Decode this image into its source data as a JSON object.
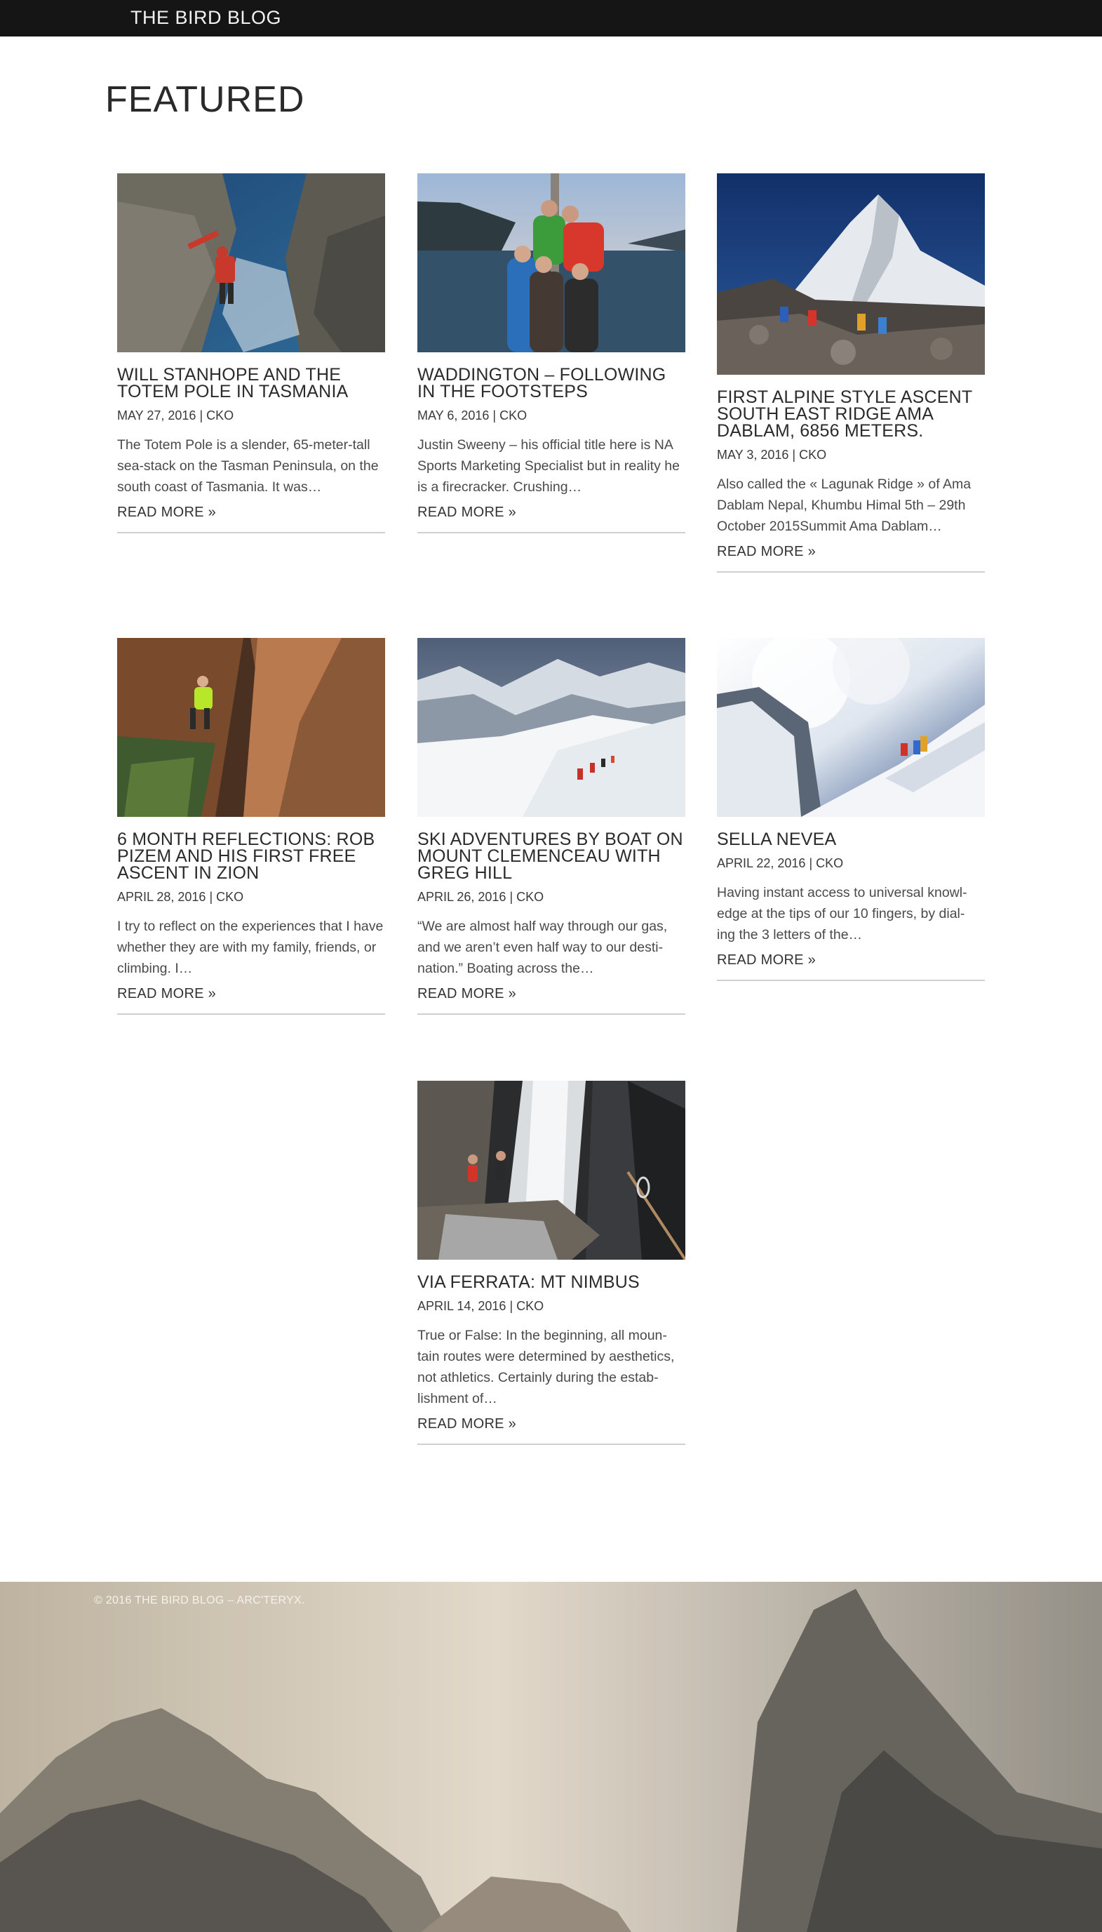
{
  "header": {
    "brand": "THE BIRD BLOG"
  },
  "section": {
    "title": "FEATURED"
  },
  "posts": [
    {
      "title": "WILL STANHOPE AND THE TOTEM POLE IN TASMANIA",
      "date": "MAY 27, 2016",
      "separator": "|",
      "author": "CKO",
      "excerpt": "The Totem Pole is a slender, 65-meter-tall sea-stack on the Tasman Peninsula, on the south coast of Tasmania. It was…",
      "read_more": "READ MORE »"
    },
    {
      "title": "WADDINGTON – FOLLOWING IN THE FOOTSTEPS",
      "date": "MAY 6, 2016",
      "separator": "|",
      "author": "CKO",
      "excerpt": "Justin Sweeny – his official title here is NA Sports Marketing Specialist but in reality he is a firecracker. Crushing…",
      "read_more": "READ MORE »"
    },
    {
      "title": "FIRST ALPINE STYLE ASCENT SOUTH EAST RIDGE AMA DABLAM, 6856 METERS.",
      "date": "MAY 3, 2016",
      "separator": "|",
      "author": "CKO",
      "excerpt": "Also called the « Lagunak Ridge » of Ama Dablam Nepal, Khumbu Himal 5th – 29th October 2015Summit Ama Dablam…",
      "read_more": "READ MORE »"
    },
    {
      "title": "6 MONTH REFLECTIONS: ROB PIZEM AND HIS FIRST FREE ASCENT IN ZION",
      "date": "APRIL 28, 2016",
      "separator": "|",
      "author": "CKO",
      "excerpt": "I try to reflect on the experiences that I have whether they are with my family, friends, or climbing. I…",
      "read_more": "READ MORE »"
    },
    {
      "title": "SKI ADVENTURES BY BOAT ON MOUNT CLEMENCEAU WITH GREG HILL",
      "date": "APRIL 26, 2016",
      "separator": "|",
      "author": "CKO",
      "excerpt": "“We are almost half way through our gas, and we aren’t even half way to our desti- nation.” Boating across the…",
      "read_more": "READ MORE »"
    },
    {
      "title": "SELLA NEVEA",
      "date": "APRIL 22, 2016",
      "separator": "|",
      "author": "CKO",
      "excerpt": "Having instant access to universal knowl- edge at the tips of our 10 fingers, by dial- ing the 3 letters of the…",
      "read_more": "READ MORE »"
    },
    {
      "title": "VIA FERRATA: MT NIMBUS",
      "date": "APRIL 14, 2016",
      "separator": "|",
      "author": "CKO",
      "excerpt": "True or False: In the beginning, all moun- tain routes were determined by aesthetics, not athletics. Certainly during the estab- lishment of…",
      "read_more": "READ MORE »"
    }
  ],
  "footer": {
    "copyright": "© 2016 THE BIRD BLOG – ARC'TERYX."
  },
  "colors": {
    "topbar": "#151515",
    "separator": "#cfcfcf",
    "text": "#2b2b2b"
  }
}
